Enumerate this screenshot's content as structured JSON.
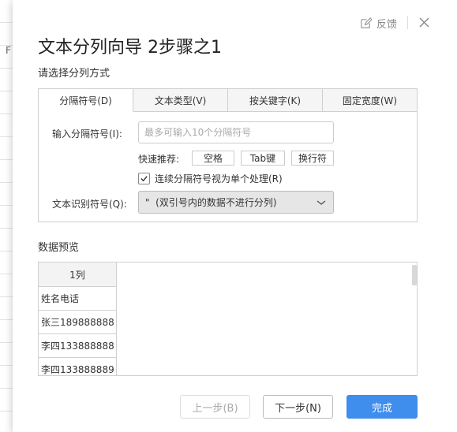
{
  "background": {
    "column_letter": "F"
  },
  "dialog": {
    "feedback_label": "反馈",
    "title": "文本分列向导 2步骤之1",
    "subtitle": "请选择分列方式",
    "tabs": [
      {
        "label": "分隔符号(D)",
        "active": true
      },
      {
        "label": "文本类型(V)",
        "active": false
      },
      {
        "label": "按关键字(K)",
        "active": false
      },
      {
        "label": "固定宽度(W)",
        "active": false
      }
    ],
    "delimiter": {
      "input_label": "输入分隔符号(I):",
      "input_value": "",
      "input_placeholder": "最多可输入10个分隔符号",
      "quick_label": "快速推荐:",
      "quick_buttons": [
        "空格",
        "Tab键",
        "换行符"
      ],
      "consecutive_label": "连续分隔符号视为单个处理(R)",
      "consecutive_checked": true,
      "qualifier_label": "文本识别符号(Q):",
      "qualifier_value": "\"  (双引号内的数据不进行分列)"
    },
    "preview": {
      "title": "数据预览",
      "column_header": "1列",
      "rows": [
        "姓名电话",
        "张三189888888",
        "李四133888888",
        "李四133888889"
      ]
    },
    "buttons": {
      "prev": "上一步(B)",
      "next": "下一步(N)",
      "finish": "完成"
    },
    "colors": {
      "accent": "#3f8ded"
    }
  }
}
